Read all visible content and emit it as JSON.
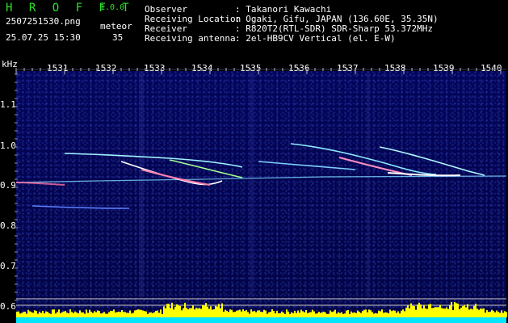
{
  "app": {
    "name": "H R O F F T",
    "version": "1.0.0"
  },
  "file": {
    "name": "2507251530.png",
    "datetime": "25.07.25 15:30"
  },
  "detection": {
    "label": "meteor",
    "count": "35"
  },
  "info": [
    {
      "key": "Observer",
      "value": ": Takanori Kawachi"
    },
    {
      "key": "Receiving Location",
      "value": ": Ogaki, Gifu, JAPAN (136.60E, 35.35N)"
    },
    {
      "key": "Receiver",
      "value": ": R820T2(RTL-SDR) SDR-Sharp 53.372MHz"
    },
    {
      "key": "Receiving antenna",
      "value": ": 2el-HB9CV Vertical (el. E-W)"
    }
  ],
  "axis": {
    "y_unit": "kHz",
    "y_ticks": [
      "1.1",
      "1.0",
      "0.9",
      "0.8",
      "0.7",
      "0.6"
    ],
    "x_ticks": [
      "1531",
      "1532",
      "1533",
      "1534",
      "1535",
      "1536",
      "1537",
      "1538",
      "1539",
      "1540"
    ]
  },
  "colors": {
    "background": "#000000",
    "title": "#29e329",
    "plot_bg": "#02034a",
    "level_bar": "#ffff00",
    "baseline": "#00ffff"
  }
}
